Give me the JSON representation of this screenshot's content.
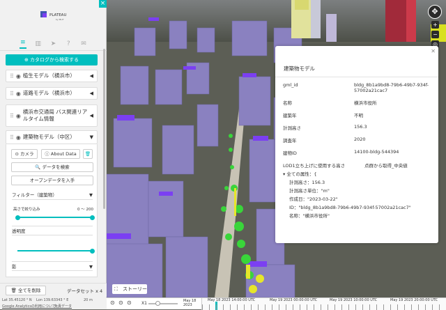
{
  "sidebar": {
    "catalog_button": "カタログから検索する",
    "layers": [
      {
        "label": "植生モデル（横浜市）"
      },
      {
        "label": "道路モデル（横浜市）"
      },
      {
        "label": "横浜市交通局 バス関連リアルタイム情報"
      },
      {
        "label": "建築物モデル（中区）"
      }
    ],
    "camera_button": "カメラ",
    "about_button": "About Data",
    "search_data_button": "データを検索",
    "open_data_button": "オープンデータを入手",
    "filter_label": "フィルター（建築物）",
    "height_filter_label": "高さで絞り込み",
    "height_filter_range": "0 ～ 200",
    "height_filter_min": 0,
    "height_filter_max": 200,
    "opacity_label": "透明度",
    "opacity_level": 1.0,
    "shadow_label": "影",
    "delete_all_button": "全てを削除",
    "dataset_count": "データセット x 4",
    "status": {
      "lat": "Lat 35.45120 ° N",
      "lon": "Lon 139.63343 ° E",
      "scale": "20 m",
      "analytics_link": "Google Analyticsの利用について",
      "terms_link": "免責データ"
    }
  },
  "info_panel": {
    "title": "建築物モデル",
    "rows": [
      {
        "k": "gml_id",
        "v": "bldg_8b1a9bd8-79b6-49b7-934f-57002a21cac7"
      },
      {
        "k": "名称",
        "v": "横浜市役所"
      },
      {
        "k": "建築年",
        "v": "不明"
      },
      {
        "k": "計測高さ",
        "v": "156.3"
      },
      {
        "k": "調査年",
        "v": "2020"
      },
      {
        "k": "建物ID",
        "v": "14100-bldg-544394"
      },
      {
        "k": "LOD1立ち上げに使用する高さ",
        "v": "点群から取得_中央値"
      }
    ],
    "attr_header": "全ての属性：{",
    "attrs": [
      "計測高さ：156.3",
      "計測高さ単位：\"m\"",
      "作成日：\"2023-03-22\"",
      "ID：\"bldg_8b1a9bd8-79b6-49b7-934f-57002a21cac7\"",
      "名称：\"横浜市役所\""
    ]
  },
  "story_button": "ストーリー",
  "timeline": {
    "speed": "X1",
    "date_label": "May 18 2023",
    "ticks": [
      "May 18 2023 14:00:00 UTC",
      "May 19 2023 00:00:00 UTC",
      "May 19 2023 10:00:00 UTC",
      "May 19 2023 20:00:00 UTC"
    ]
  },
  "colors": {
    "accent": "#00bebe",
    "building": "#8e83c4",
    "roof_purple": "#7b3ff2"
  }
}
